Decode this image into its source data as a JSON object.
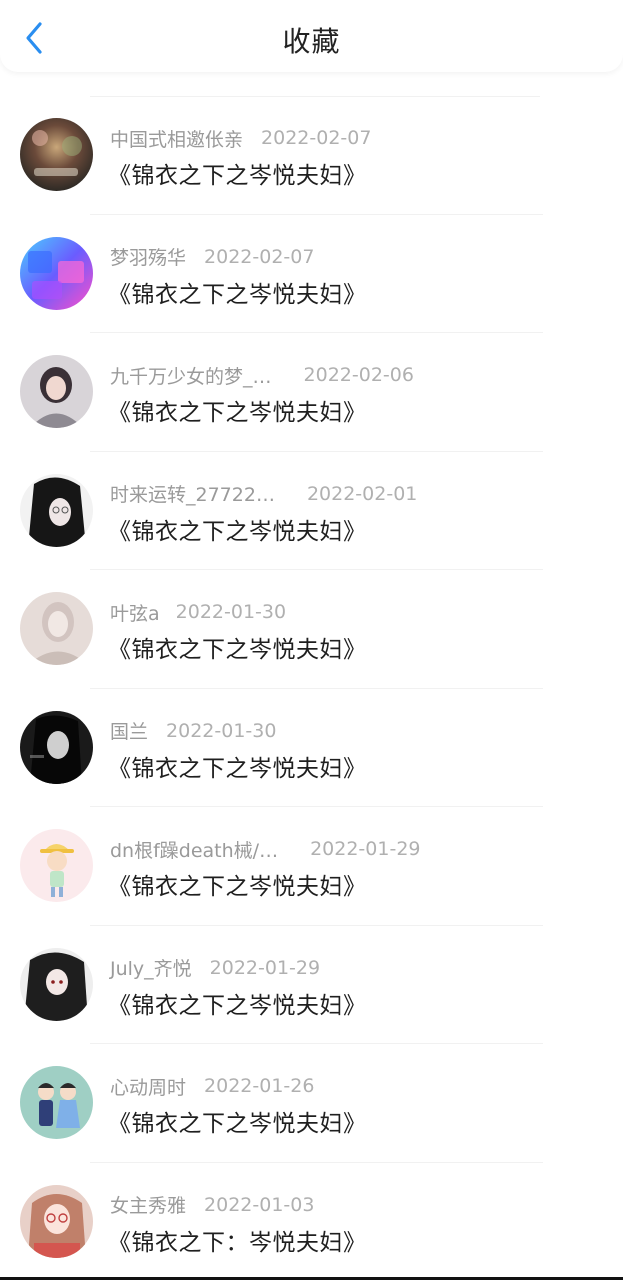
{
  "header": {
    "title": "收藏",
    "back_icon": "chevron-left-icon",
    "accent": "#2a8ef0"
  },
  "items": [
    {
      "user": "中国式相邀伥亲",
      "date": "2022-02-07",
      "title": "《锦衣之下之岑悦夫妇》"
    },
    {
      "user": "梦羽殇华",
      "date": "2022-02-07",
      "title": "《锦衣之下之岑悦夫妇》"
    },
    {
      "user": "九千万少女的梦_…",
      "date": "2022-02-06",
      "title": "《锦衣之下之岑悦夫妇》"
    },
    {
      "user": "时来运转_27722…",
      "date": "2022-02-01",
      "title": "《锦衣之下之岑悦夫妇》"
    },
    {
      "user": "叶弦a",
      "date": "2022-01-30",
      "title": "《锦衣之下之岑悦夫妇》"
    },
    {
      "user": "国兰",
      "date": "2022-01-30",
      "title": "《锦衣之下之岑悦夫妇》"
    },
    {
      "user": "dn根f躁death械/…",
      "date": "2022-01-29",
      "title": "《锦衣之下之岑悦夫妇》"
    },
    {
      "user": "July_齐悦",
      "date": "2022-01-29",
      "title": "《锦衣之下之岑悦夫妇》"
    },
    {
      "user": "心动周时",
      "date": "2022-01-26",
      "title": "《锦衣之下之岑悦夫妇》"
    },
    {
      "user": "女主秀雅",
      "date": "2022-01-03",
      "title": "《锦衣之下：岑悦夫妇》"
    }
  ]
}
